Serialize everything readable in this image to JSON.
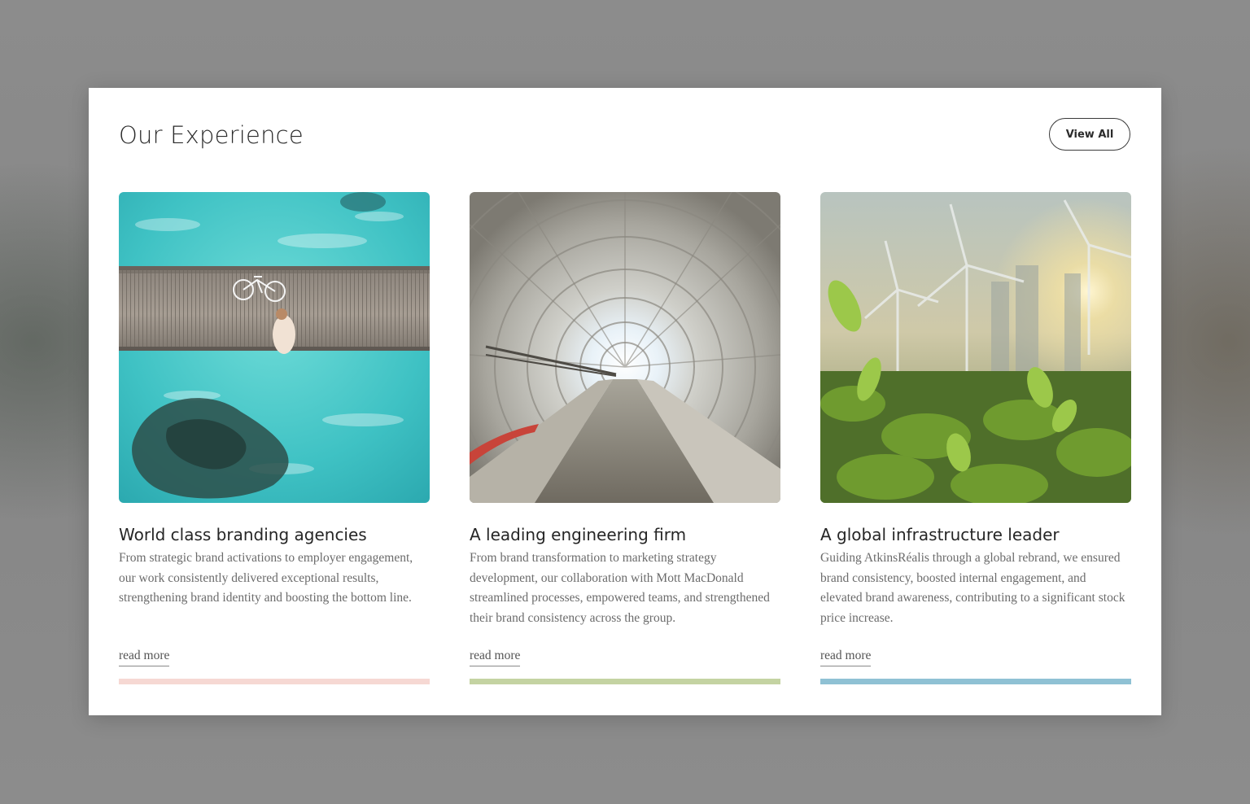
{
  "section": {
    "title": "Our Experience",
    "view_all_label": "View All"
  },
  "cards": [
    {
      "title": "World class branding agencies",
      "description": "From strategic brand activations to employer engagement, our work consistently delivered exceptional results, strengthening brand identity and boosting the bottom line.",
      "read_more": "read more",
      "accent_color": "#f6d8d3",
      "image": "aerial-boardwalk-ocean"
    },
    {
      "title": "A leading engineering firm",
      "description": "From brand transformation to marketing strategy development, our collaboration with Mott MacDonald streamlined processes, empowered teams, and strengthened their brand consistency across the group.",
      "read_more": "read more",
      "accent_color": "#c4d3a2",
      "image": "concrete-tunnel"
    },
    {
      "title": "A global infrastructure leader",
      "description": "Guiding AtkinsRéalis through a global rebrand, we ensured brand consistency, boosted internal engagement, and elevated brand awareness, contributing to a significant stock price increase.",
      "read_more": "read more",
      "accent_color": "#8fc1d4",
      "image": "wind-turbines-plants"
    }
  ]
}
